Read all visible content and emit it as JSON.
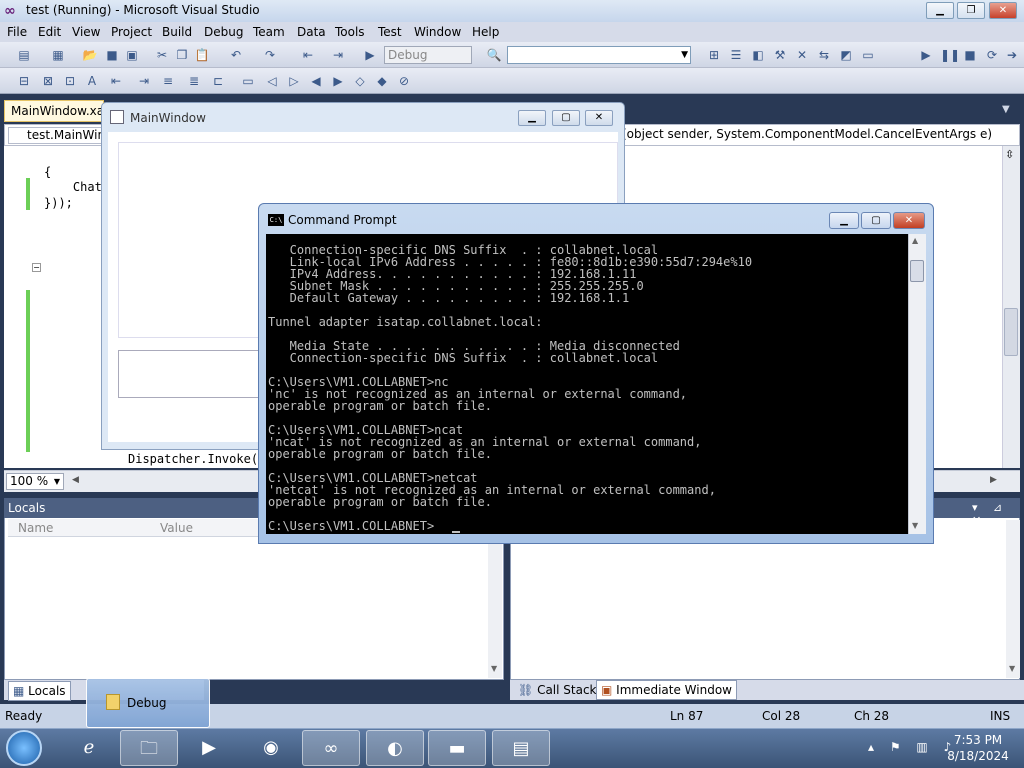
{
  "vs": {
    "title": "test (Running) - Microsoft Visual Studio",
    "min_glyph": "▁",
    "max_glyph": "❐",
    "close_glyph": "✕",
    "menu": [
      "File",
      "Edit",
      "View",
      "Project",
      "Build",
      "Debug",
      "Team",
      "Data",
      "Tools",
      "Test",
      "Window",
      "Help"
    ],
    "config_combo": "Debug",
    "doc_tab": "MainWindow.xaml.cs",
    "class_combo": "test.MainWindow",
    "member_combo": "(object sender, System.ComponentModel.CancelEventArgs e)",
    "code_lines": [
      "{",
      "    Chat",
      "}));"
    ],
    "dispatcher_line": "Dispatcher.Invoke(n",
    "zoom": "100 %"
  },
  "locals": {
    "title": "Locals",
    "col_name": "Name",
    "col_value": "Value",
    "tab_label": "Locals"
  },
  "right_pane": {
    "tab_callstack": "Call Stack",
    "tab_immediate": "Immediate Window",
    "buttons": "▾ ⊿ ✕"
  },
  "status": {
    "ready": "Ready",
    "ln": "Ln 87",
    "col": "Col 28",
    "ch": "Ch 28",
    "ins": "INS"
  },
  "debug_thumb": {
    "label": "Debug"
  },
  "mainwindow": {
    "title": "MainWindow"
  },
  "cmd": {
    "title": "Command Prompt",
    "lines": [
      "   Connection-specific DNS Suffix  . : collabnet.local",
      "   Link-local IPv6 Address . . . . . : fe80::8d1b:e390:55d7:294e%10",
      "   IPv4 Address. . . . . . . . . . . : 192.168.1.11",
      "   Subnet Mask . . . . . . . . . . . : 255.255.255.0",
      "   Default Gateway . . . . . . . . . : 192.168.1.1",
      "",
      "Tunnel adapter isatap.collabnet.local:",
      "",
      "   Media State . . . . . . . . . . . : Media disconnected",
      "   Connection-specific DNS Suffix  . : collabnet.local",
      "",
      "C:\\Users\\VM1.COLLABNET>nc",
      "'nc' is not recognized as an internal or external command,",
      "operable program or batch file.",
      "",
      "C:\\Users\\VM1.COLLABNET>ncat",
      "'ncat' is not recognized as an internal or external command,",
      "operable program or batch file.",
      "",
      "C:\\Users\\VM1.COLLABNET>netcat",
      "'netcat' is not recognized as an internal or external command,",
      "operable program or batch file.",
      "",
      "C:\\Users\\VM1.COLLABNET>"
    ]
  },
  "taskbar": {
    "time": "7:53 PM",
    "date": "8/18/2024"
  }
}
